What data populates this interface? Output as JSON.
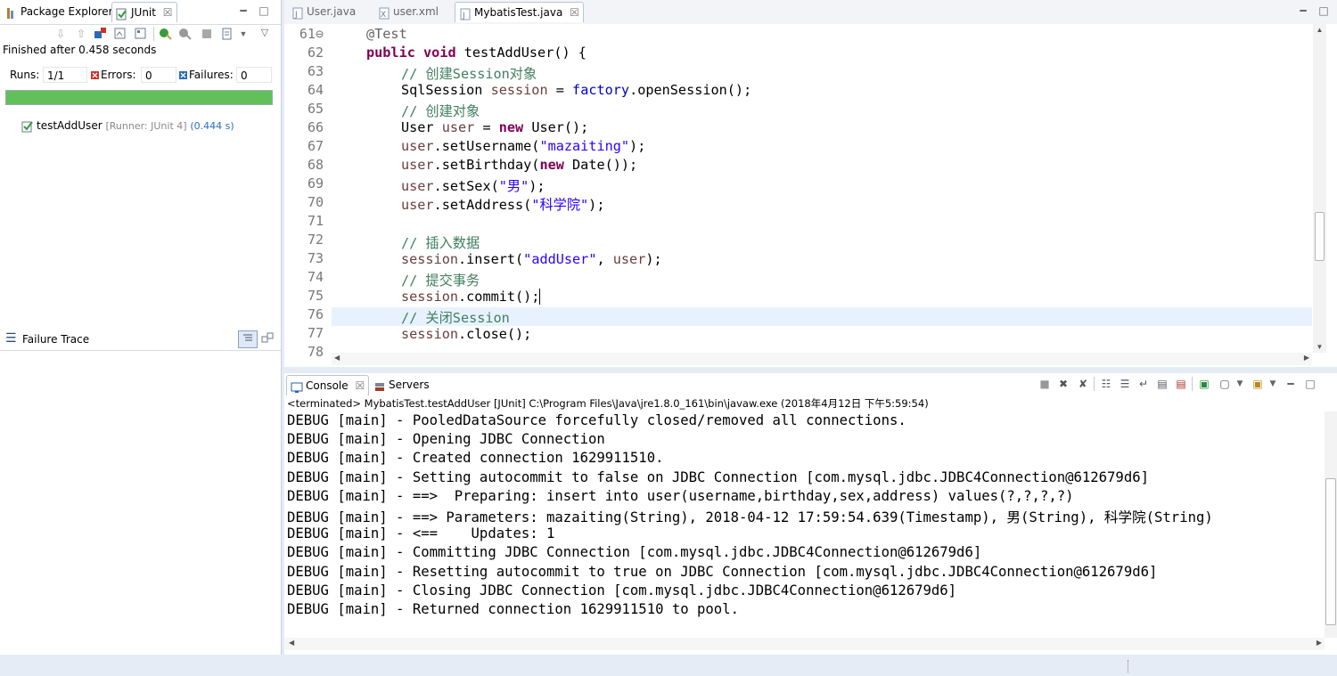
{
  "left_pane": {
    "tabs": [
      {
        "label": "Package Explorer",
        "icon": "package-explorer-icon"
      },
      {
        "label": "JUnit",
        "icon": "junit-icon",
        "close": "☒"
      }
    ],
    "finished_text": "Finished after 0.458 seconds",
    "runs_label": "Runs:",
    "runs_value": "1/1",
    "errors_label": "Errors:",
    "errors_value": "0",
    "failures_label": "Failures:",
    "failures_value": "0",
    "progress_fraction": 1.0,
    "progress_color": "#61c05a",
    "test": {
      "name": "testAddUser",
      "runner": "[Runner: JUnit 4]",
      "time": "(0.444 s)"
    },
    "failure_trace_label": "Failure Trace"
  },
  "editor": {
    "tabs": [
      {
        "label": "User.java"
      },
      {
        "label": "user.xml"
      },
      {
        "label": "MybatisTest.java",
        "close": "☒"
      }
    ],
    "line_numbers": [
      "61⊖",
      "62",
      "63",
      "64",
      "65",
      "66",
      "67",
      "68",
      "69",
      "70",
      "71",
      "72",
      "73",
      "74",
      "75",
      "76",
      "77",
      "78"
    ]
  },
  "console": {
    "tabs": [
      {
        "label": "Console",
        "close": "☒"
      },
      {
        "label": "Servers"
      }
    ],
    "description": "<terminated> MybatisTest.testAddUser [JUnit] C:\\Program Files\\Java\\jre1.8.0_161\\bin\\javaw.exe (2018年4月12日 下午5:59:54)",
    "lines": [
      "DEBUG [main] - PooledDataSource forcefully closed/removed all connections.",
      "DEBUG [main] - Opening JDBC Connection",
      "DEBUG [main] - Created connection 1629911510.",
      "DEBUG [main] - Setting autocommit to false on JDBC Connection [com.mysql.jdbc.JDBC4Connection@612679d6]",
      "DEBUG [main] - ==>  Preparing: insert into user(username,birthday,sex,address) values(?,?,?,?)",
      "DEBUG [main] - ==> Parameters: mazaiting(String), 2018-04-12 17:59:54.639(Timestamp), 男(String), 科学院(String)",
      "DEBUG [main] - <==    Updates: 1",
      "DEBUG [main] - Committing JDBC Connection [com.mysql.jdbc.JDBC4Connection@612679d6]",
      "DEBUG [main] - Resetting autocommit to true on JDBC Connection [com.mysql.jdbc.JDBC4Connection@612679d6]",
      "DEBUG [main] - Closing JDBC Connection [com.mysql.jdbc.JDBC4Connection@612679d6]",
      "DEBUG [main] - Returned connection 1629911510 to pool."
    ]
  },
  "colors": {
    "keyword": "#7f0055",
    "comment": "#3f7f5f",
    "string": "#2a00ff",
    "field": "#0000c0",
    "current_line": "#e8f2fe",
    "error_red": "#d0302a",
    "window_bg": "#e6ecf5"
  }
}
